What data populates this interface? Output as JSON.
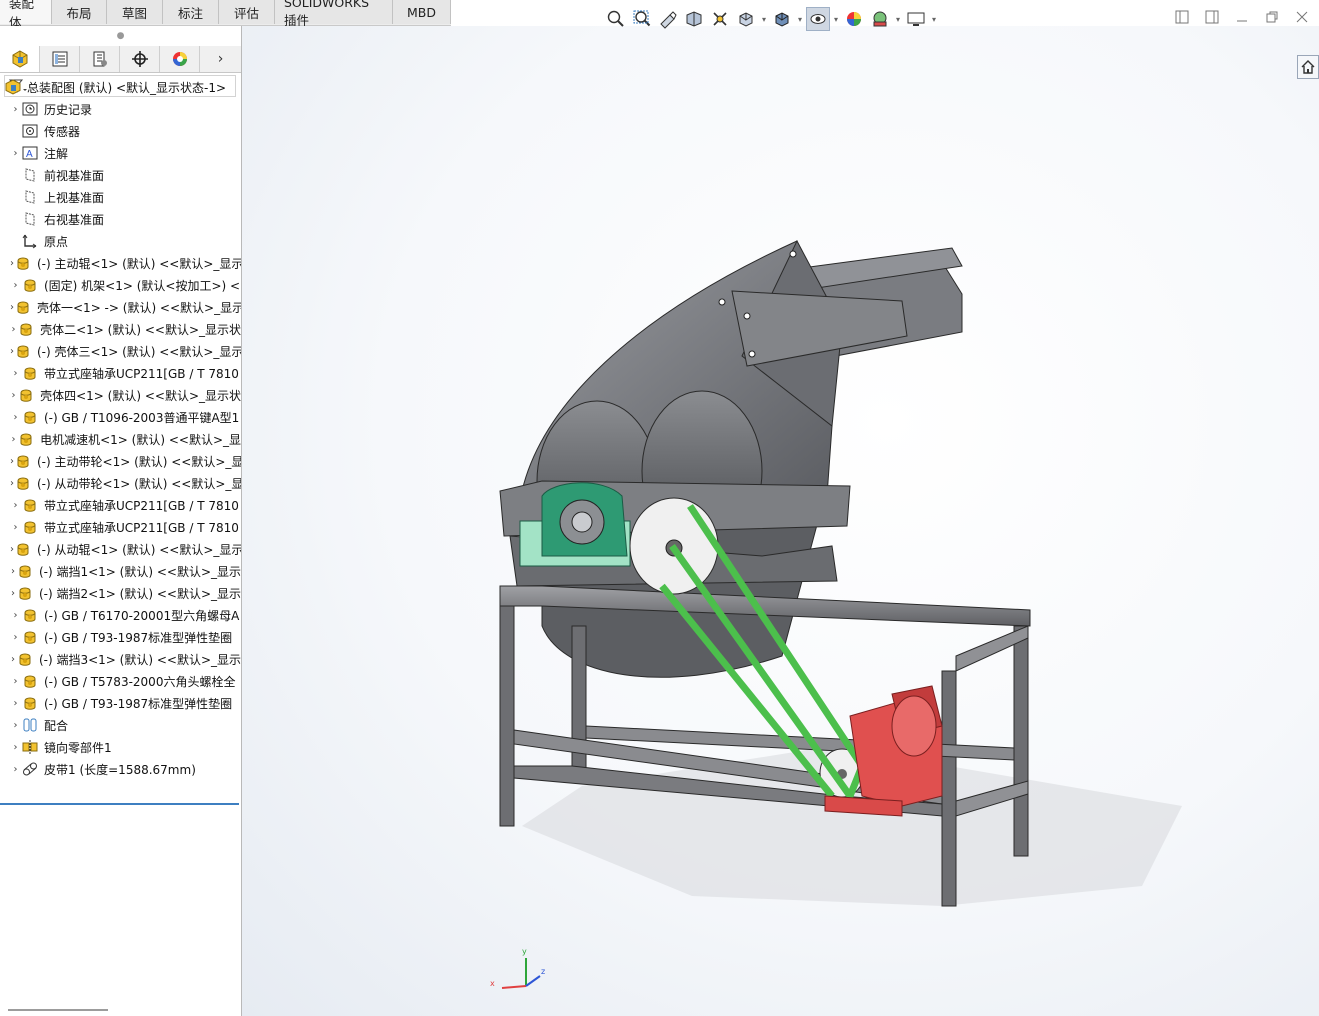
{
  "command_tabs": [
    {
      "label": "装配体",
      "active": true
    },
    {
      "label": "布局",
      "active": false
    },
    {
      "label": "草图",
      "active": false
    },
    {
      "label": "标注",
      "active": false
    },
    {
      "label": "评估",
      "active": false
    },
    {
      "label": "SOLIDWORKS 插件",
      "active": false
    },
    {
      "label": "MBD",
      "active": false
    }
  ],
  "heads_up_toolbar": [
    "zoom-to-fit-icon",
    "zoom-to-area-icon",
    "previous-view-icon",
    "section-view-icon",
    "dynamic-annotation-icon",
    "view-orientation-icon",
    "display-style-icon",
    "hide-show-items-icon",
    "edit-appearance-icon",
    "apply-scene-icon",
    "view-settings-icon"
  ],
  "panel_tabs": [
    "feature-manager-icon",
    "property-manager-icon",
    "configuration-manager-icon",
    "dimxpert-icon",
    "display-manager-icon"
  ],
  "tree": {
    "root": "总装配图 (默认) <默认_显示状态-1>",
    "items": [
      {
        "label": "历史记录",
        "icon": "history-icon",
        "expandable": true
      },
      {
        "label": "传感器",
        "icon": "sensor-icon",
        "expandable": false
      },
      {
        "label": "注解",
        "icon": "annotation-icon",
        "expandable": true
      },
      {
        "label": "前视基准面",
        "icon": "plane-icon",
        "expandable": false
      },
      {
        "label": "上视基准面",
        "icon": "plane-icon",
        "expandable": false
      },
      {
        "label": "右视基准面",
        "icon": "plane-icon",
        "expandable": false
      },
      {
        "label": "原点",
        "icon": "origin-icon",
        "expandable": false
      },
      {
        "label": "(-) 主动辊<1> (默认) <<默认>_显示",
        "icon": "part-icon",
        "expandable": true
      },
      {
        "label": "(固定) 机架<1> (默认<按加工>) <",
        "icon": "part-icon",
        "expandable": true
      },
      {
        "label": "壳体一<1> -> (默认) <<默认>_显示",
        "icon": "part-icon",
        "expandable": true
      },
      {
        "label": "壳体二<1> (默认) <<默认>_显示状",
        "icon": "part-icon",
        "expandable": true
      },
      {
        "label": "(-) 壳体三<1> (默认) <<默认>_显示",
        "icon": "part-icon",
        "expandable": true
      },
      {
        "label": "带立式座轴承UCP211[GB / T 7810",
        "icon": "part-icon",
        "expandable": true
      },
      {
        "label": "壳体四<1> (默认) <<默认>_显示状",
        "icon": "part-icon",
        "expandable": true
      },
      {
        "label": "(-) GB / T1096-2003普通平键A型1",
        "icon": "part-icon",
        "expandable": true
      },
      {
        "label": "电机减速机<1> (默认) <<默认>_显",
        "icon": "part-icon",
        "expandable": true
      },
      {
        "label": "(-) 主动带轮<1> (默认) <<默认>_显",
        "icon": "part-icon",
        "expandable": true
      },
      {
        "label": "(-) 从动带轮<1> (默认) <<默认>_显",
        "icon": "part-icon",
        "expandable": true
      },
      {
        "label": "带立式座轴承UCP211[GB / T 7810",
        "icon": "part-icon",
        "expandable": true
      },
      {
        "label": "带立式座轴承UCP211[GB / T 7810",
        "icon": "part-icon",
        "expandable": true
      },
      {
        "label": "(-) 从动辊<1> (默认) <<默认>_显示",
        "icon": "part-icon",
        "expandable": true
      },
      {
        "label": "(-) 端挡1<1> (默认) <<默认>_显示",
        "icon": "part-icon",
        "expandable": true
      },
      {
        "label": "(-) 端挡2<1> (默认) <<默认>_显示",
        "icon": "part-icon",
        "expandable": true
      },
      {
        "label": "(-) GB / T6170-20001型六角螺母A",
        "icon": "part-icon",
        "expandable": true
      },
      {
        "label": "(-) GB / T93-1987标准型弹性垫圈",
        "icon": "part-icon",
        "expandable": true
      },
      {
        "label": "(-) 端挡3<1> (默认) <<默认>_显示",
        "icon": "part-icon",
        "expandable": true
      },
      {
        "label": "(-) GB / T5783-2000六角头螺栓全",
        "icon": "part-icon",
        "expandable": true
      },
      {
        "label": "(-) GB / T93-1987标准型弹性垫圈",
        "icon": "part-icon",
        "expandable": true
      },
      {
        "label": "配合",
        "icon": "mates-icon",
        "expandable": true
      },
      {
        "label": "镜向零部件1",
        "icon": "mirror-component-icon",
        "expandable": true
      },
      {
        "label": "皮带1 (长度=1588.67mm)",
        "icon": "belt-icon",
        "expandable": true
      }
    ]
  },
  "triad": {
    "x_label": "x",
    "y_label": "y",
    "z_label": "z"
  },
  "colors": {
    "belt": "#4cbf4c",
    "bearing": "#2e9a73",
    "motor": "#e0504f",
    "frame": "#7b7c80",
    "tab_bar": "#ececec",
    "tree_end": "#3d7fc1"
  }
}
